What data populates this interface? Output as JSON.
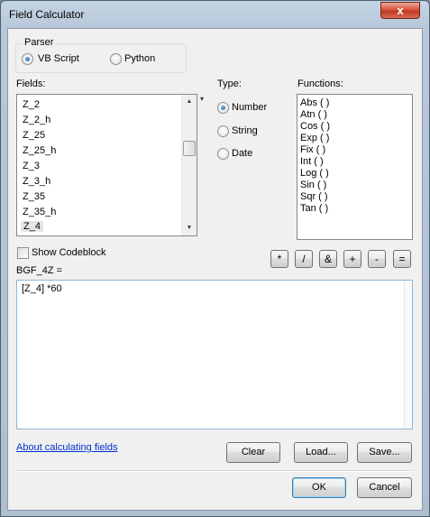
{
  "window": {
    "title": "Field Calculator",
    "close_glyph": "x"
  },
  "parser": {
    "legend": "Parser",
    "options": [
      "VB Script",
      "Python"
    ],
    "selected": "VB Script"
  },
  "fields": {
    "label": "Fields:",
    "items": [
      "Z_2",
      "Z_2_h",
      "Z_25",
      "Z_25_h",
      "Z_3",
      "Z_3_h",
      "Z_35",
      "Z_35_h",
      "Z_4"
    ],
    "selected": "Z_4"
  },
  "type": {
    "label": "Type:",
    "options": [
      "Number",
      "String",
      "Date"
    ],
    "selected": "Number"
  },
  "functions": {
    "label": "Functions:",
    "items": [
      "Abs ( )",
      "Atn ( )",
      "Cos ( )",
      "Exp ( )",
      "Fix ( )",
      "Int ( )",
      "Log ( )",
      "Sin ( )",
      "Sqr ( )",
      "Tan ( )"
    ]
  },
  "show_codeblock": {
    "label": "Show Codeblock",
    "checked": false
  },
  "operators": [
    "*",
    "/",
    "&",
    "+",
    "-",
    "="
  ],
  "expression": {
    "label": "BGF_4Z =",
    "value": "[Z_4] *60"
  },
  "link": {
    "text": "About calculating fields"
  },
  "buttons": {
    "clear": "Clear",
    "load": "Load...",
    "save": "Save...",
    "ok": "OK",
    "cancel": "Cancel"
  }
}
